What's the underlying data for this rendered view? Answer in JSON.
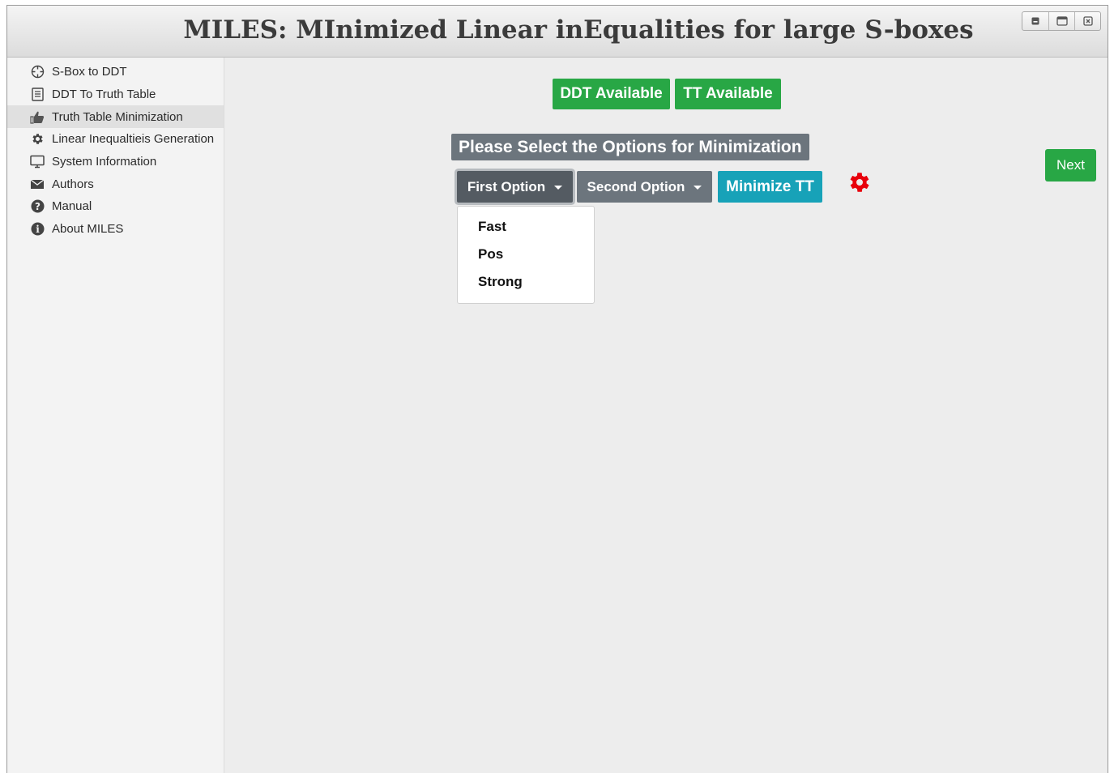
{
  "window": {
    "title": "MILES: MInimized Linear inEqualities for large S-boxes",
    "controls": [
      "minimize-icon",
      "maximize-icon",
      "close-icon"
    ]
  },
  "sidebar": {
    "items": [
      {
        "label": "S-Box to DDT",
        "icon": "crosshair-icon",
        "active": false
      },
      {
        "label": "DDT To Truth Table",
        "icon": "document-icon",
        "active": false
      },
      {
        "label": "Truth Table Minimization",
        "icon": "thumbs-up-icon",
        "active": true
      },
      {
        "label": "Linear Inequaltieis Generation",
        "icon": "gear-icon",
        "active": false
      },
      {
        "label": "System Information",
        "icon": "monitor-icon",
        "active": false
      },
      {
        "label": "Authors",
        "icon": "envelope-icon",
        "active": false
      },
      {
        "label": "Manual",
        "icon": "question-icon",
        "active": false
      },
      {
        "label": "About MILES",
        "icon": "info-icon",
        "active": false
      }
    ]
  },
  "main": {
    "status_badges": {
      "ddt": "DDT Available",
      "tt": "TT Available"
    },
    "heading": "Please Select the Options for Minimization",
    "first_option_label": "First Option",
    "second_option_label": "Second Option",
    "minimize_label": "Minimize TT",
    "next_label": "Next",
    "dropdown": {
      "items": [
        "Fast",
        "Pos",
        "Strong"
      ]
    },
    "spinner_icon": "gear-icon"
  },
  "colors": {
    "green": "#28a745",
    "teal": "#17a2b8",
    "grey": "#6c757d",
    "spinner_red": "#e8000b"
  }
}
